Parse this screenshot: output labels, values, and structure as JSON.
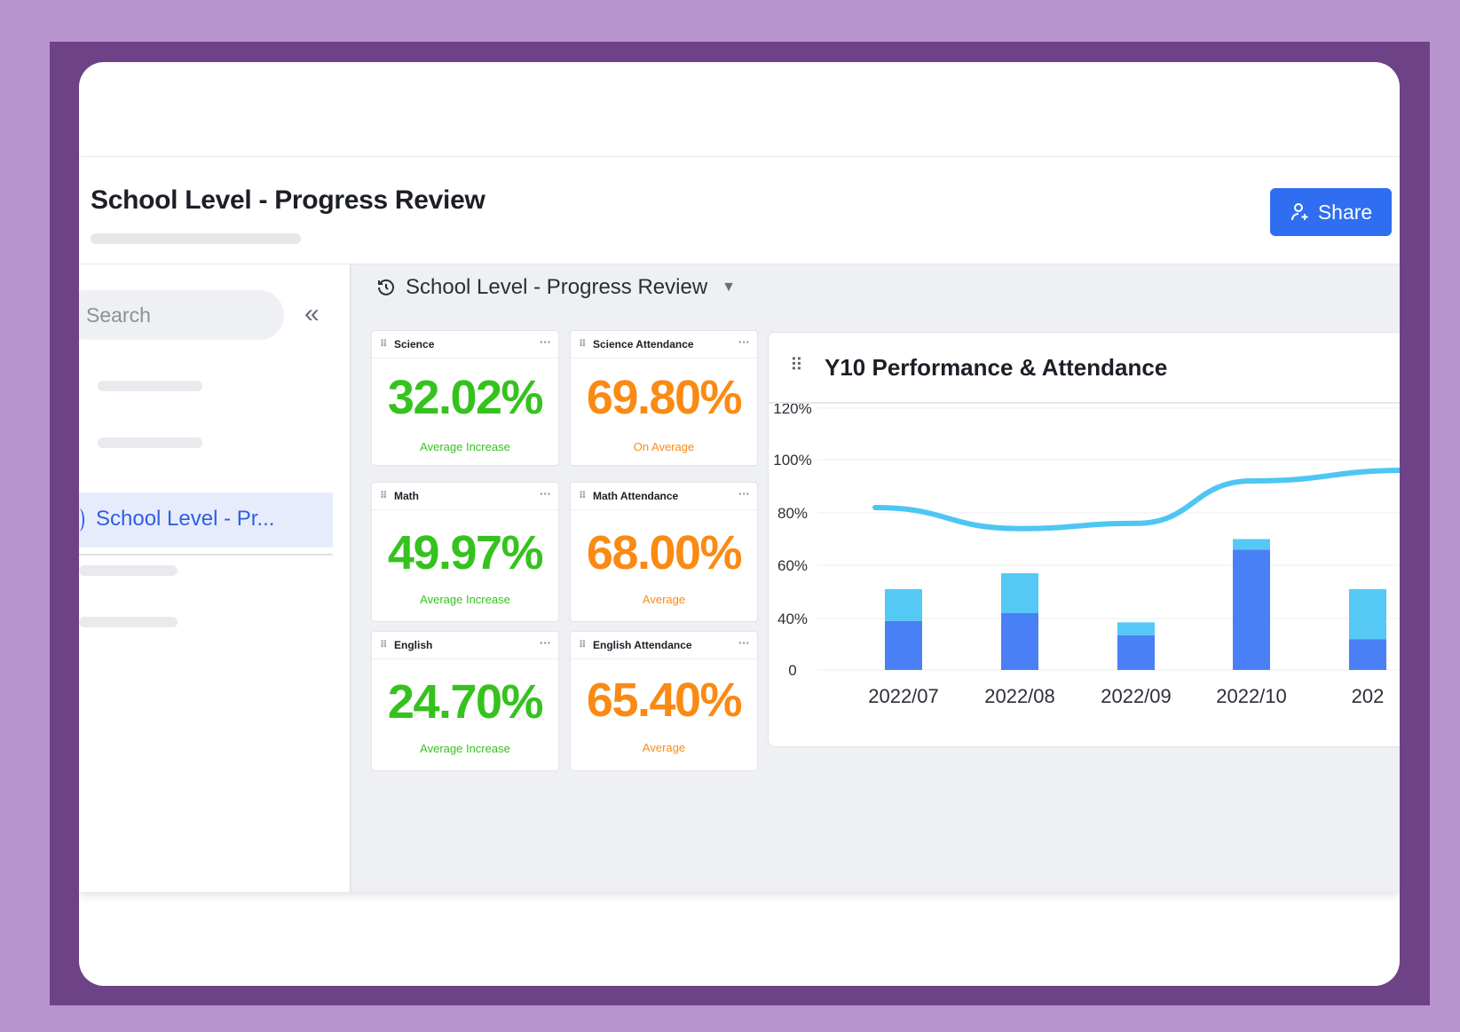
{
  "app": {
    "page_title": "School Level - Progress Review",
    "share_label": "Share"
  },
  "sidebar": {
    "search_placeholder": "Search",
    "active_item": "School Level - Pr..."
  },
  "dashboard": {
    "breadcrumb": "School Level - Progress Review",
    "tiles": [
      {
        "name": "Science",
        "value": "32.02%",
        "caption": "Average Increase",
        "color": "#35c21e"
      },
      {
        "name": "Science Attendance",
        "value": "69.80%",
        "caption": "On Average",
        "color": "#fa8a14"
      },
      {
        "name": "Math",
        "value": "49.97%",
        "caption": "Average Increase",
        "color": "#35c21e"
      },
      {
        "name": "Math Attendance",
        "value": "68.00%",
        "caption": "Average",
        "color": "#fa8a14"
      },
      {
        "name": "English",
        "value": "24.70%",
        "caption": "Average Increase",
        "color": "#35c21e"
      },
      {
        "name": "English Attendance",
        "value": "65.40%",
        "caption": "Average",
        "color": "#fa8a14"
      }
    ]
  },
  "chart_data": {
    "type": "bar",
    "title": "Y10 Performance & Attendance",
    "categories": [
      "2022/07",
      "2022/08",
      "2022/09",
      "2022/10",
      "202"
    ],
    "y_ticks": [
      "0",
      "40%",
      "60%",
      "80%",
      "100%",
      "120%"
    ],
    "series": [
      {
        "values": [
          38,
          42,
          27,
          66,
          24
        ],
        "color": "#4a80f6"
      },
      {
        "values": [
          13,
          15,
          10,
          4,
          27
        ],
        "color": "#55c8f5"
      },
      {
        "type": "line",
        "values": [
          82,
          74,
          76,
          92,
          96
        ],
        "color": "#4ec6f3"
      }
    ],
    "stacked": true,
    "grid": true
  }
}
